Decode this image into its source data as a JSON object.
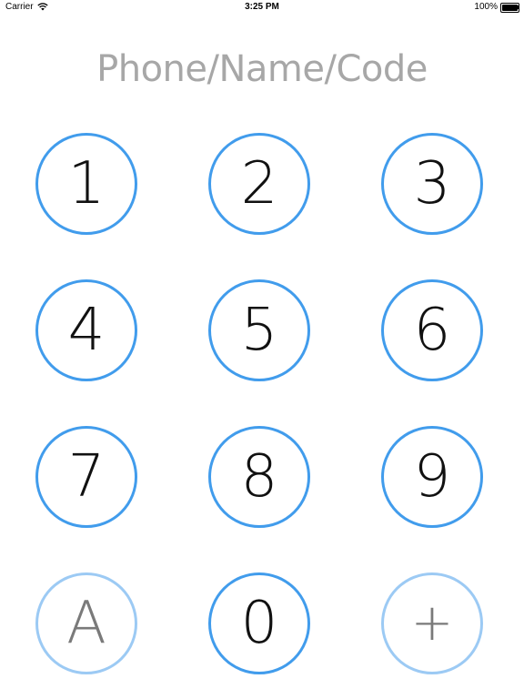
{
  "status_bar": {
    "carrier": "Carrier",
    "time": "3:25 PM",
    "battery": "100%"
  },
  "entry": {
    "placeholder": "Phone/Name/Code"
  },
  "keys": [
    {
      "label": "1"
    },
    {
      "label": "2"
    },
    {
      "label": "3"
    },
    {
      "label": "4"
    },
    {
      "label": "5"
    },
    {
      "label": "6"
    },
    {
      "label": "7"
    },
    {
      "label": "8"
    },
    {
      "label": "9"
    },
    {
      "label": "A"
    },
    {
      "label": "0"
    },
    {
      "label": "+"
    }
  ],
  "colors": {
    "key_border": "#419cec",
    "key_border_light": "#9ccaf4",
    "placeholder_text": "#a7a7a7"
  }
}
